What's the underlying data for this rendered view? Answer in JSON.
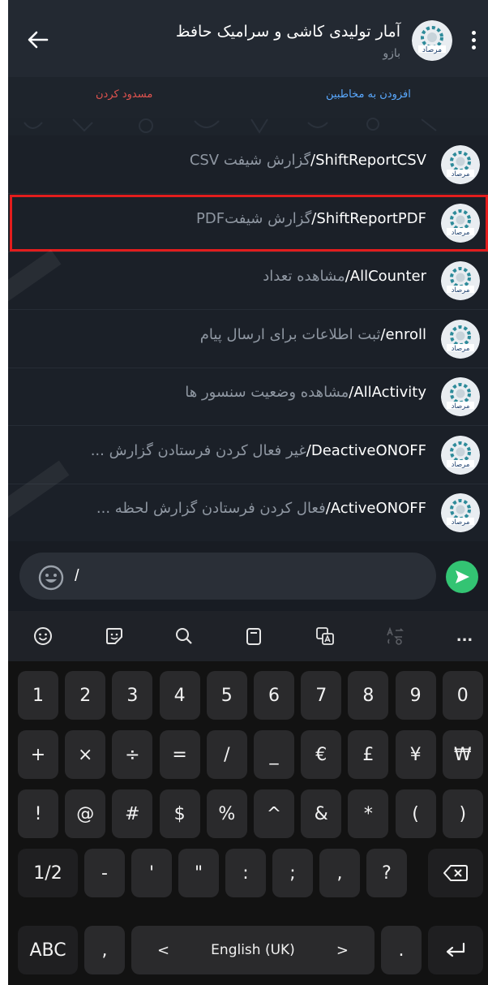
{
  "header": {
    "title": "آمار تولیدی کاشی و سرامیک حافظ",
    "subtitle": "بازو",
    "avatar_text": "مرصاد"
  },
  "actions": {
    "add_contact": "افزودن به مخاطبین",
    "block": "مسدود کردن"
  },
  "commands": [
    {
      "command": "/ShiftReportCSV",
      "description": "گزارش شیفت CSV"
    },
    {
      "command": "/ShiftReportPDF",
      "description": "گزارش شیفتPDF"
    },
    {
      "command": "/AllCounter",
      "description": "مشاهده تعداد"
    },
    {
      "command": "/enroll",
      "description": "ثبت اطلاعات برای ارسال پیام"
    },
    {
      "command": "/AllActivity",
      "description": "مشاهده وضعیت سنسور ها"
    },
    {
      "command": "/DeactiveONOFF",
      "description": "غیر فعال کردن فرستادن گزارش ..."
    },
    {
      "command": "/ActiveONOFF",
      "description": "فعال کردن فرستادن گزارش لحظه ..."
    }
  ],
  "selected_command_index": 1,
  "input": {
    "value": "/"
  },
  "keyboard": {
    "toolbar": [
      "emoji-icon",
      "sticker-icon",
      "search-icon",
      "clipboard-icon",
      "translate-icon",
      "text-transform-icon",
      "more-icon"
    ],
    "more_label": "...",
    "row1": [
      "1",
      "2",
      "3",
      "4",
      "5",
      "6",
      "7",
      "8",
      "9",
      "0"
    ],
    "row2": [
      "+",
      "×",
      "÷",
      "=",
      "/",
      "_",
      "€",
      "£",
      "¥",
      "₩"
    ],
    "row3": [
      "!",
      "@",
      "#",
      "$",
      "%",
      "^",
      "&",
      "*",
      "(",
      ")"
    ],
    "row4": [
      "1/2",
      "-",
      "'",
      "\"",
      ":",
      ";",
      ",",
      "?"
    ],
    "row5": {
      "abc": "ABC",
      "comma": ",",
      "left": "<",
      "space": "English (UK)",
      "right": ">",
      "period": "."
    }
  },
  "colors": {
    "accent_green": "#33c473",
    "link_blue": "#5aa9ff",
    "danger_red": "#e0534f",
    "highlight_red": "#e21d1d"
  }
}
